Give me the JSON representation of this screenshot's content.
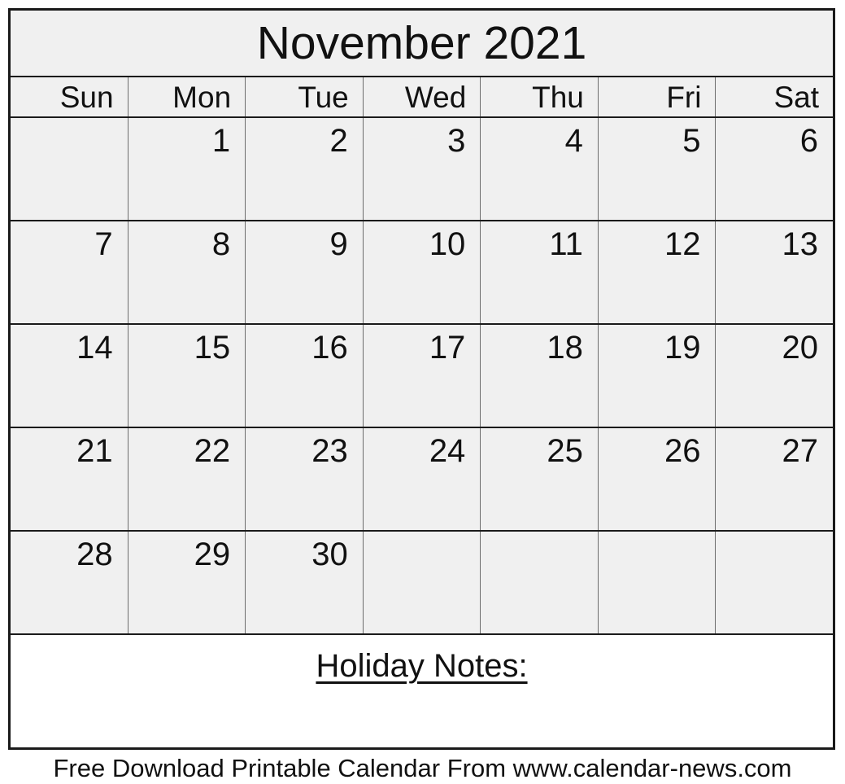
{
  "calendar": {
    "title": "November 2021",
    "month": "November",
    "year": "2021",
    "weekday_headers": [
      "Sun",
      "Mon",
      "Tue",
      "Wed",
      "Thu",
      "Fri",
      "Sat"
    ],
    "weeks": [
      [
        "",
        "1",
        "2",
        "3",
        "4",
        "5",
        "6"
      ],
      [
        "7",
        "8",
        "9",
        "10",
        "11",
        "12",
        "13"
      ],
      [
        "14",
        "15",
        "16",
        "17",
        "18",
        "19",
        "20"
      ],
      [
        "21",
        "22",
        "23",
        "24",
        "25",
        "26",
        "27"
      ],
      [
        "28",
        "29",
        "30",
        "",
        "",
        "",
        ""
      ]
    ],
    "notes": {
      "label": "Holiday Notes:",
      "content": ""
    }
  },
  "footer": {
    "text": "Free Download Printable Calendar From www.calendar-news.com"
  },
  "colors": {
    "cell_background": "#f0f0f0",
    "notes_background": "#ffffff",
    "page_background": "#ffffff",
    "outer_border": "#1a1a1a",
    "inner_border": "#6d6d6d",
    "text": "#111111"
  }
}
